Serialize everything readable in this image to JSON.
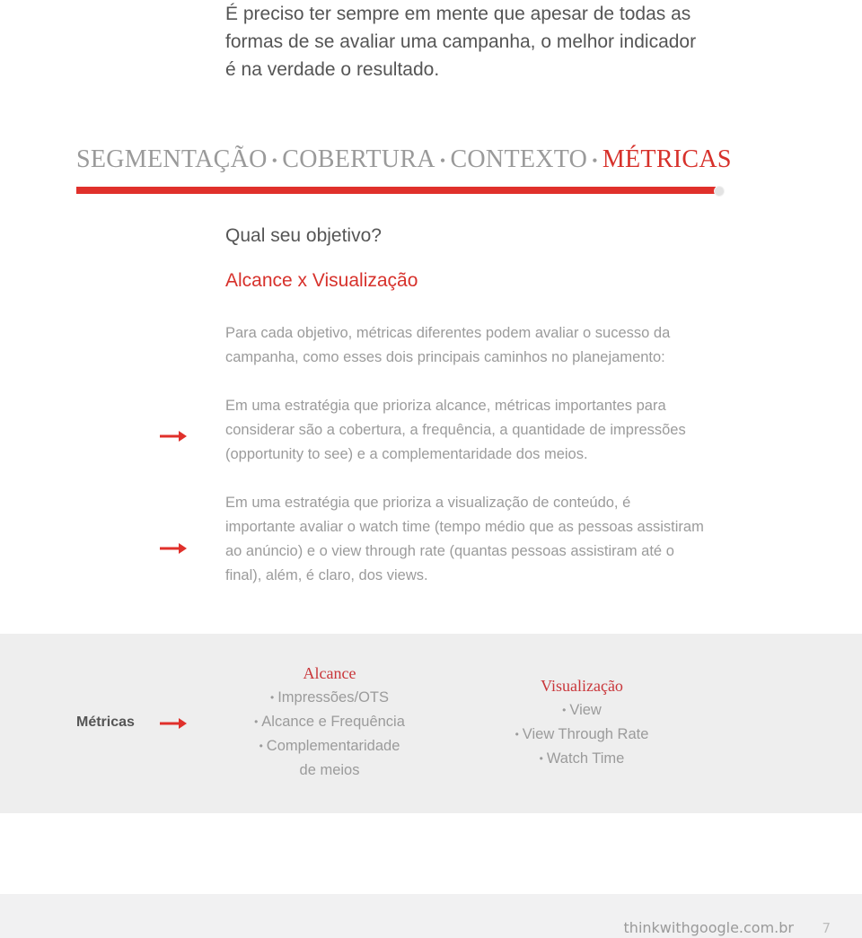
{
  "intro": {
    "lines": [
      "É preciso ter sempre em mente que apesar de todas as",
      "formas de se avaliar uma campanha, o melhor indicador",
      "é na verdade o resultado."
    ]
  },
  "nav": {
    "items": [
      {
        "label": "SEGMENTAÇÃO",
        "active": false
      },
      {
        "label": "COBERTURA",
        "active": false
      },
      {
        "label": "CONTEXTO",
        "active": false
      },
      {
        "label": "MÉTRICAS",
        "active": true
      }
    ],
    "separator": "•",
    "progress": 1.0,
    "colors": {
      "active": "#d7312b",
      "inactive": "#9a9a9a",
      "bar": "#e0302b"
    }
  },
  "question": "Qual seu objetivo?",
  "subtitle": "Alcance x Visualização",
  "paragraphs": {
    "intro": [
      "Para cada objetivo, métricas diferentes podem avaliar o sucesso da",
      "campanha, como esses dois principais caminhos no planejamento:"
    ],
    "reach": [
      "Em uma estratégia que prioriza alcance, métricas importantes para",
      "considerar são a cobertura, a frequência, a quantidade de impressões",
      "(opportunity to see) e a complementaridade dos meios."
    ],
    "view": [
      "Em uma estratégia que prioriza a visualização de conteúdo, é",
      "importante avaliar o watch time (tempo médio que as pessoas assistiram",
      "ao anúncio) e o view through rate (quantas pessoas assistiram até o",
      "final), além, é claro, dos views."
    ]
  },
  "icons": {
    "arrow": "right-arrow-icon"
  },
  "metrics": {
    "label": "Métricas",
    "columns": [
      {
        "title": "Alcance",
        "items": [
          "Impressões/OTS",
          "Alcance e Frequência",
          "Complementaridade"
        ],
        "continuation": "de meios"
      },
      {
        "title": "Visualização",
        "items": [
          "View",
          "View Through Rate",
          "Watch Time"
        ]
      }
    ],
    "bullet": "•"
  },
  "footer": {
    "site": "thinkwithgoogle.com.br",
    "page": "7"
  }
}
